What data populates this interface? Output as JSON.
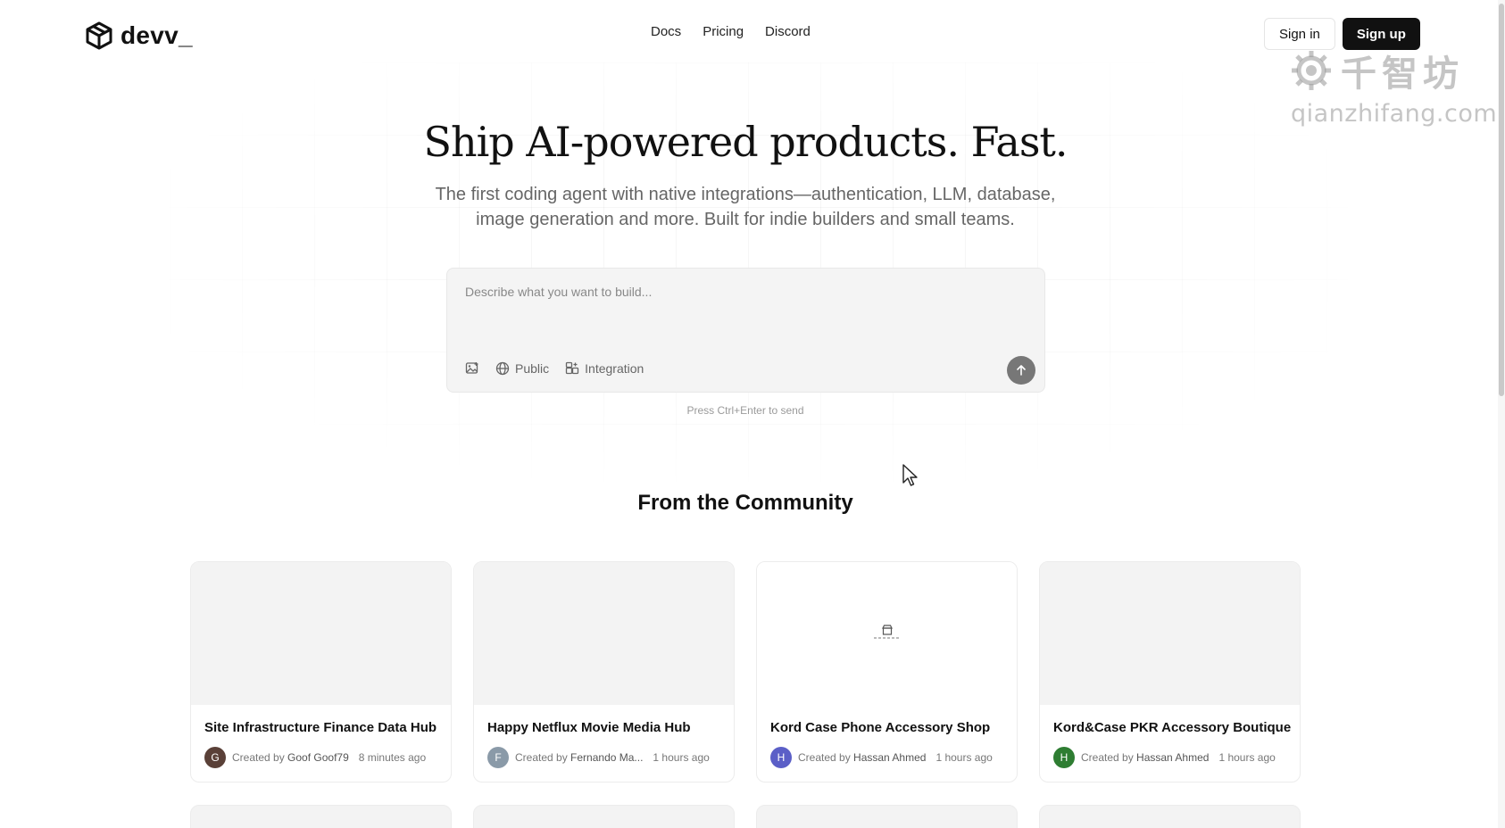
{
  "header": {
    "logo_text": "devv_",
    "nav": [
      "Docs",
      "Pricing",
      "Discord"
    ],
    "sign_in": "Sign in",
    "sign_up": "Sign up"
  },
  "watermark": {
    "cn": "千智坊",
    "url": "qianzhifang.com"
  },
  "hero": {
    "title": "Ship AI-powered products. Fast.",
    "subtitle_line1": "The first coding agent with native integrations—authentication, LLM, database,",
    "subtitle_line2": "image generation and more. Built for indie builders and small teams."
  },
  "prompt": {
    "placeholder": "Describe what you want to build...",
    "public_label": "Public",
    "integration_label": "Integration",
    "hint": "Press Ctrl+Enter to send"
  },
  "community": {
    "title": "From the Community",
    "cards": [
      {
        "title": "Site Infrastructure Finance Data Hub",
        "created_by": "Created by",
        "author": "Goof Goof79",
        "time": "8 minutes ago",
        "initial": "G",
        "avatar_color": "#5a4038"
      },
      {
        "title": "Happy Netflux Movie Media Hub",
        "created_by": "Created by",
        "author": "Fernando Ma...",
        "time": "1 hours ago",
        "initial": "F",
        "avatar_color": "#8a9aa8"
      },
      {
        "title": "Kord Case Phone Accessory Shop",
        "created_by": "Created by",
        "author": "Hassan Ahmed",
        "time": "1 hours ago",
        "initial": "H",
        "avatar_color": "#5b5fc7"
      },
      {
        "title": "Kord&Case PKR Accessory Boutique",
        "created_by": "Created by",
        "author": "Hassan Ahmed",
        "time": "1 hours ago",
        "initial": "H",
        "avatar_color": "#2e7d32"
      }
    ]
  },
  "colors": {
    "accent": "#111111",
    "send_button": "#777777"
  }
}
